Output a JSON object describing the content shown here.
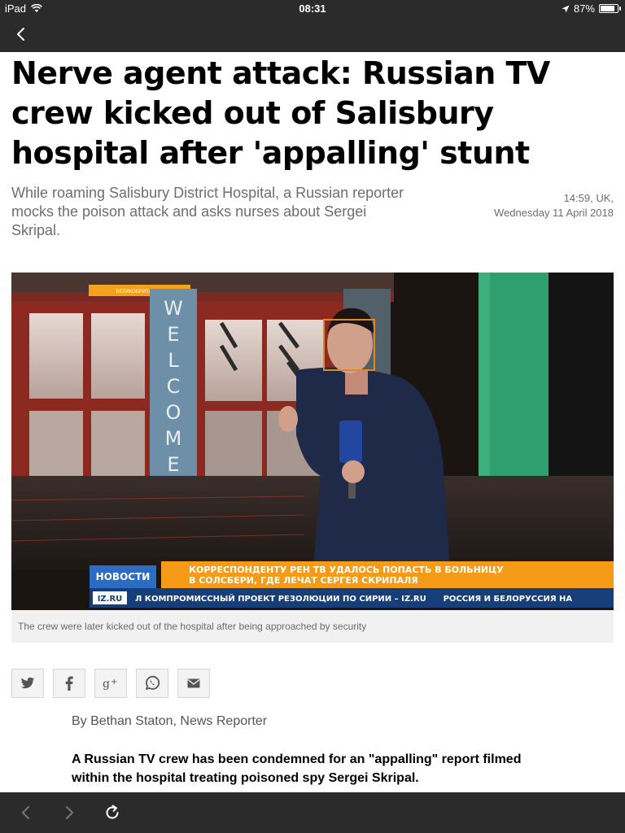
{
  "status_bar": {
    "device": "iPad",
    "time": "08:31",
    "battery": "87%",
    "battery_level": 0.87
  },
  "nav": {
    "back_icon": "chevron-left-icon"
  },
  "article": {
    "headline": "Nerve agent attack: Russian TV crew kicked out of Salisbury hospital after 'appalling' stunt",
    "standfirst": "While roaming Salisbury District Hospital, a Russian reporter mocks the poison attack and asks nurses about Sergei Skripal.",
    "date_line1": "14:59, UK,",
    "date_line2": "Wednesday 11 April 2018",
    "image": {
      "sign_text": "WELCOME",
      "sign_small": "ВЕЛИКОБРИТАНИЯ",
      "ticker_label": "НОВОСТИ",
      "ticker_headline_line1": "КОРРЕСПОНДЕНТУ РЕН ТВ УДАЛОСЬ ПОПАСТЬ В БОЛЬНИЦУ",
      "ticker_headline_line2": "В СОЛСБЕРИ, ГДЕ ЛЕЧАТ СЕРГЕЯ СКРИПАЛЯ",
      "ticker_logo": "IZ.RU",
      "ticker_crawl": "Л КОМПРОМИССНЫЙ ПРОЕКТ РЕЗОЛЮЦИИ ПО СИРИИ – IZ.RU      РОССИЯ И БЕЛОРУССИЯ НА"
    },
    "caption": "The crew were later kicked out of the hospital after being approached by security",
    "share_icons": [
      "twitter-icon",
      "facebook-icon",
      "google-plus-icon",
      "whatsapp-icon",
      "email-icon"
    ],
    "byline": "By Bethan Staton, News Reporter",
    "lead": "A Russian TV crew has been condemned for an \"appalling\" report filmed within the hospital treating poisoned spy Sergei Skripal."
  },
  "toolbar": {
    "icons": [
      "back-arrow-icon",
      "forward-arrow-icon",
      "reload-icon"
    ]
  },
  "colors": {
    "bar_bg": "#2b2b2b",
    "ticker_orange": "#f59b17",
    "ticker_blue": "#1f5ba8"
  }
}
